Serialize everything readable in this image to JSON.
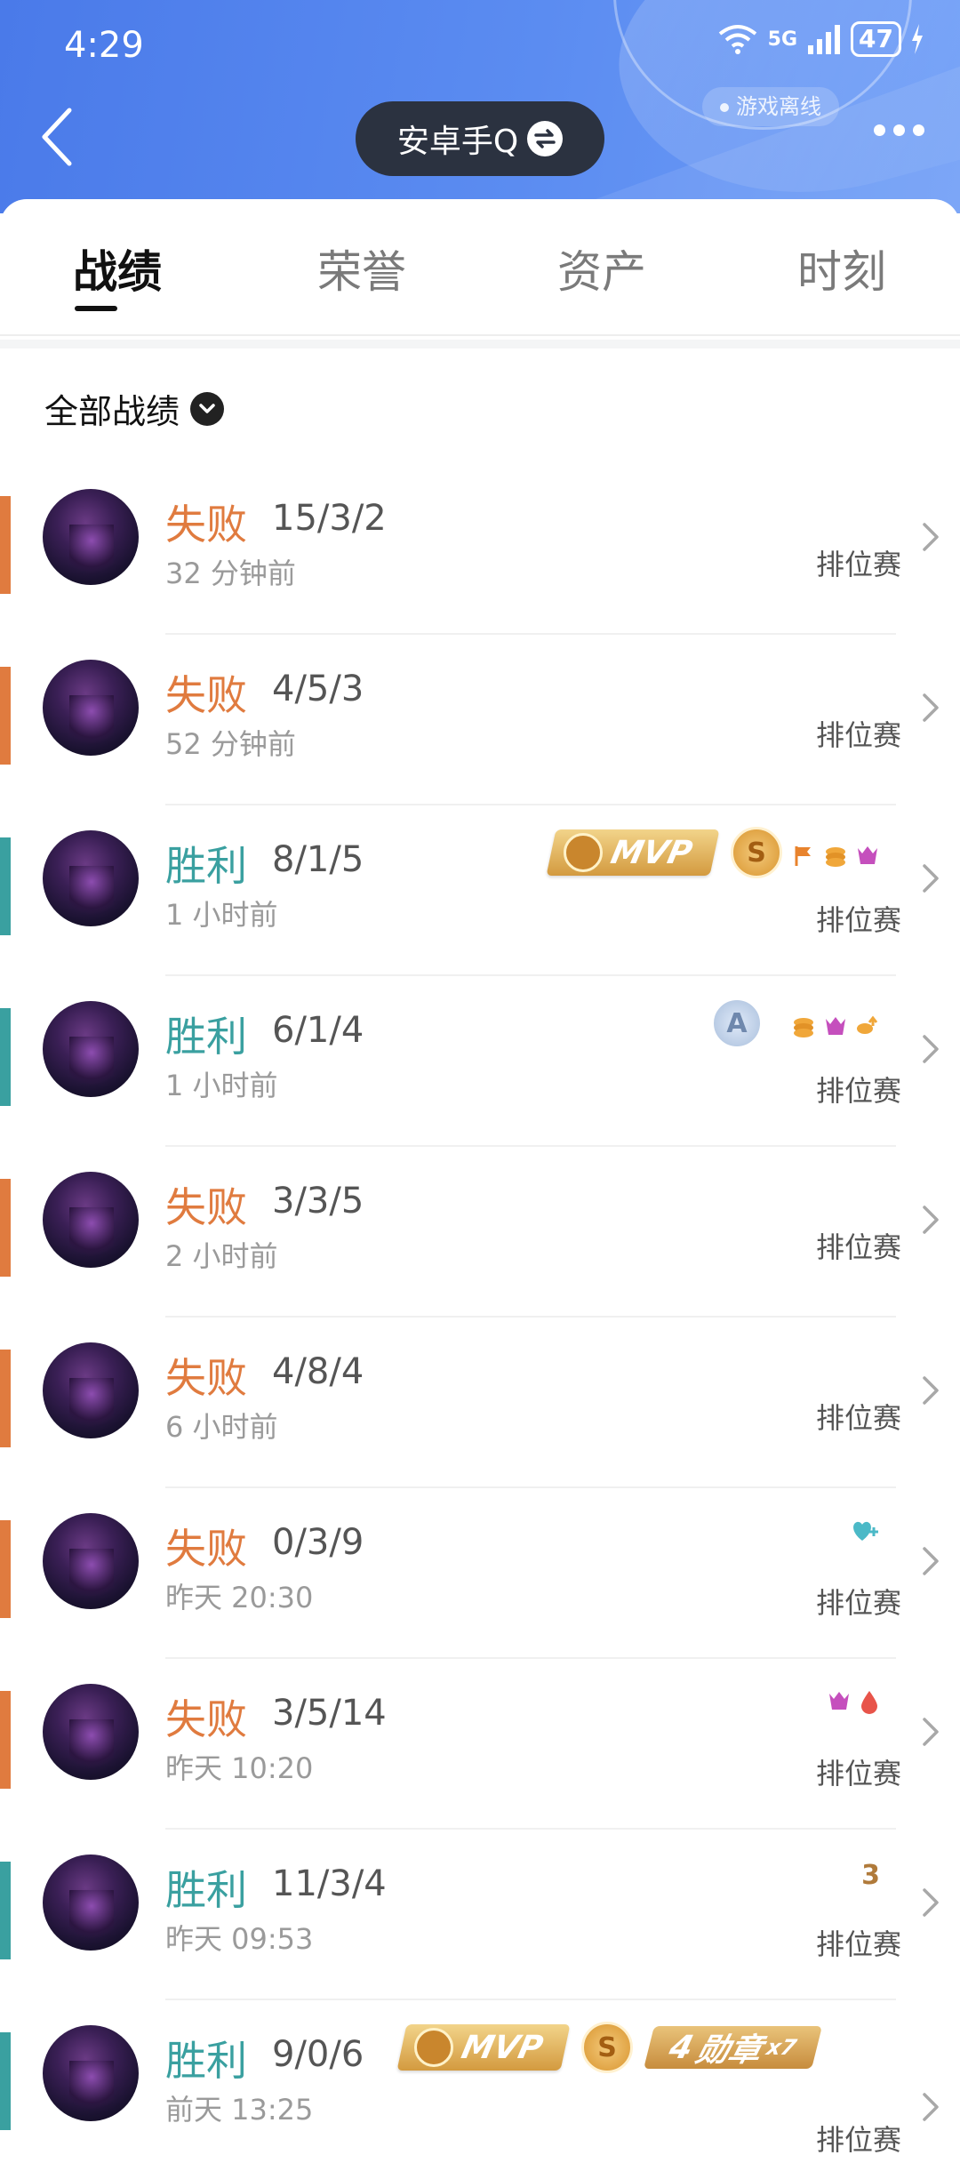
{
  "status": {
    "time": "4:29",
    "network": "5G",
    "battery": "47"
  },
  "header": {
    "title": "安卓手Q",
    "status_text": "游戏离线"
  },
  "tabs": [
    {
      "label": "战绩"
    },
    {
      "label": "荣誉"
    },
    {
      "label": "资产"
    },
    {
      "label": "时刻"
    }
  ],
  "filter": {
    "label": "全部战绩"
  },
  "colors": {
    "win": "#3aa0a0",
    "loss": "#e07b3f",
    "header": "#4a7ae9"
  },
  "matches": [
    {
      "result": "失败",
      "kda": "15/3/2",
      "time": "32 分钟前",
      "mode": "排位赛"
    },
    {
      "result": "失败",
      "kda": "4/5/3",
      "time": "52 分钟前",
      "mode": "排位赛"
    },
    {
      "result": "胜利",
      "kda": "8/1/5",
      "time": "1 小时前",
      "mode": "排位赛",
      "mvp": "MVP",
      "s_badge": "S"
    },
    {
      "result": "胜利",
      "kda": "6/1/4",
      "time": "1 小时前",
      "mode": "排位赛",
      "a_badge": "A"
    },
    {
      "result": "失败",
      "kda": "3/3/5",
      "time": "2 小时前",
      "mode": "排位赛"
    },
    {
      "result": "失败",
      "kda": "4/8/4",
      "time": "6 小时前",
      "mode": "排位赛"
    },
    {
      "result": "失败",
      "kda": "0/3/9",
      "time": "昨天 20:30",
      "mode": "排位赛"
    },
    {
      "result": "失败",
      "kda": "3/5/14",
      "time": "昨天 10:20",
      "mode": "排位赛"
    },
    {
      "result": "胜利",
      "kda": "11/3/4",
      "time": "昨天 09:53",
      "mode": "排位赛",
      "tag_text": "3"
    },
    {
      "result": "胜利",
      "kda": "9/0/6",
      "time": "前天 13:25",
      "mode": "排位赛",
      "mvp": "MVP",
      "s_badge": "S",
      "medal": "勋章",
      "medal_count": "x7",
      "medal_prefix": "4"
    }
  ]
}
